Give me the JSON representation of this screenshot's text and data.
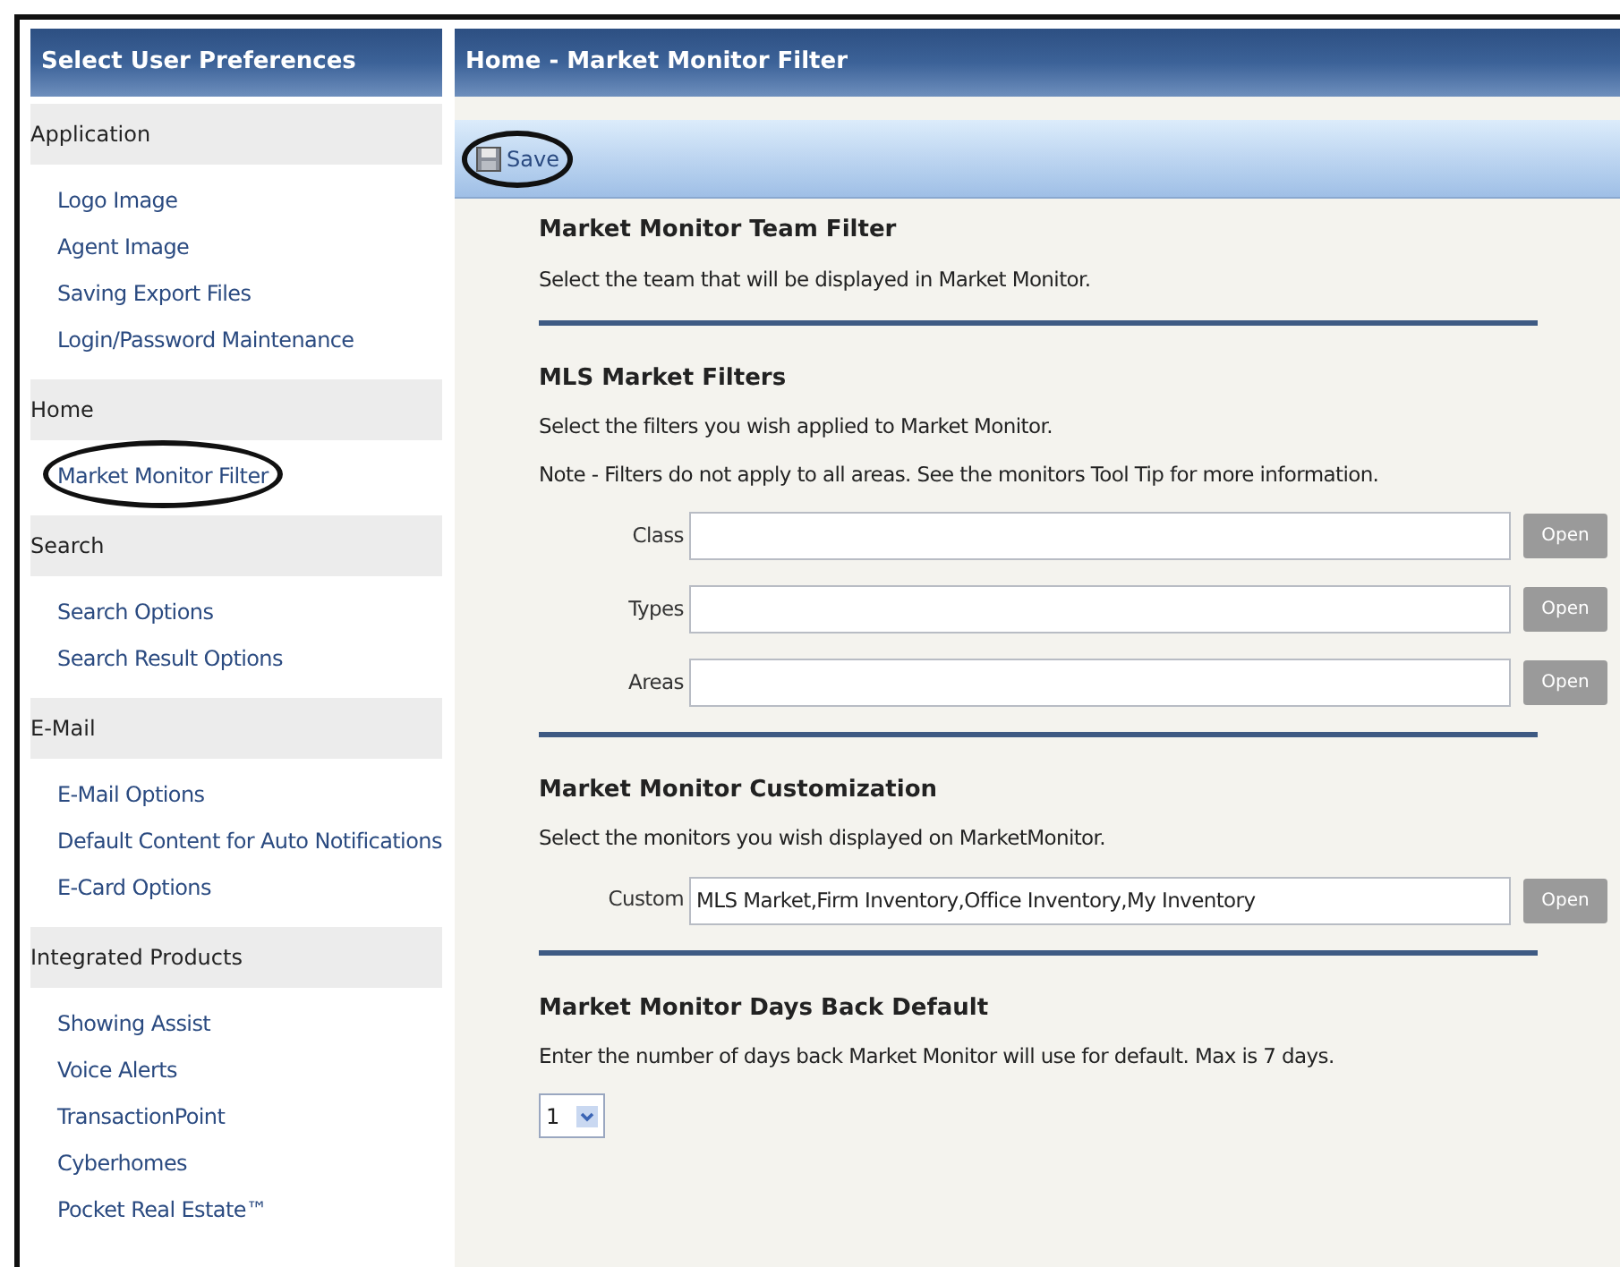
{
  "sidebar": {
    "title": "Select User Preferences",
    "groups": [
      {
        "label": "Application",
        "items": [
          {
            "label": "Logo Image",
            "circled": false
          },
          {
            "label": "Agent Image",
            "circled": false
          },
          {
            "label": "Saving Export Files",
            "circled": false
          },
          {
            "label": "Login/Password Maintenance",
            "circled": false
          }
        ]
      },
      {
        "label": "Home",
        "items": [
          {
            "label": "Market Monitor Filter",
            "circled": true
          }
        ]
      },
      {
        "label": "Search",
        "items": [
          {
            "label": "Search Options",
            "circled": false
          },
          {
            "label": "Search Result Options",
            "circled": false
          }
        ]
      },
      {
        "label": "E-Mail",
        "items": [
          {
            "label": "E-Mail Options",
            "circled": false
          },
          {
            "label": "Default Content for Auto Notifications",
            "circled": false
          },
          {
            "label": "E-Card Options",
            "circled": false
          }
        ]
      },
      {
        "label": "Integrated Products",
        "items": [
          {
            "label": "Showing Assist",
            "circled": false
          },
          {
            "label": "Voice Alerts",
            "circled": false
          },
          {
            "label": "TransactionPoint",
            "circled": false
          },
          {
            "label": "Cyberhomes",
            "circled": false
          },
          {
            "label": "Pocket Real Estate™",
            "circled": false
          }
        ]
      }
    ]
  },
  "main": {
    "title": "Home - Market Monitor Filter",
    "save_button": {
      "label": "Save",
      "circled": true
    },
    "sections": [
      {
        "title": "Market Monitor Team Filter",
        "notes": [
          "Select the team that will be displayed in Market Monitor."
        ]
      },
      {
        "title": "MLS Market Filters",
        "notes": [
          "Select the filters you wish applied to Market Monitor.",
          "Note - Filters do not apply to all areas. See the monitors Tool Tip for more information."
        ],
        "fields": [
          {
            "label": "Class",
            "button": "Open"
          },
          {
            "label": "Types",
            "button": "Open"
          },
          {
            "label": "Areas",
            "button": "Open"
          }
        ]
      },
      {
        "title": "Market Monitor Customization",
        "notes": [
          "Select the monitors you wish displayed on MarketMonitor."
        ],
        "fields": [
          {
            "label": "Custom",
            "value": "MLS Market,Firm Inventory,Office Inventory,My Inventory",
            "button": "Open"
          }
        ]
      },
      {
        "title": "Market Monitor Days Back Default",
        "notes": [
          "Enter the number of days back Market Monitor will use for default. Max is 7 days."
        ],
        "select": {
          "value": "1"
        }
      }
    ]
  }
}
